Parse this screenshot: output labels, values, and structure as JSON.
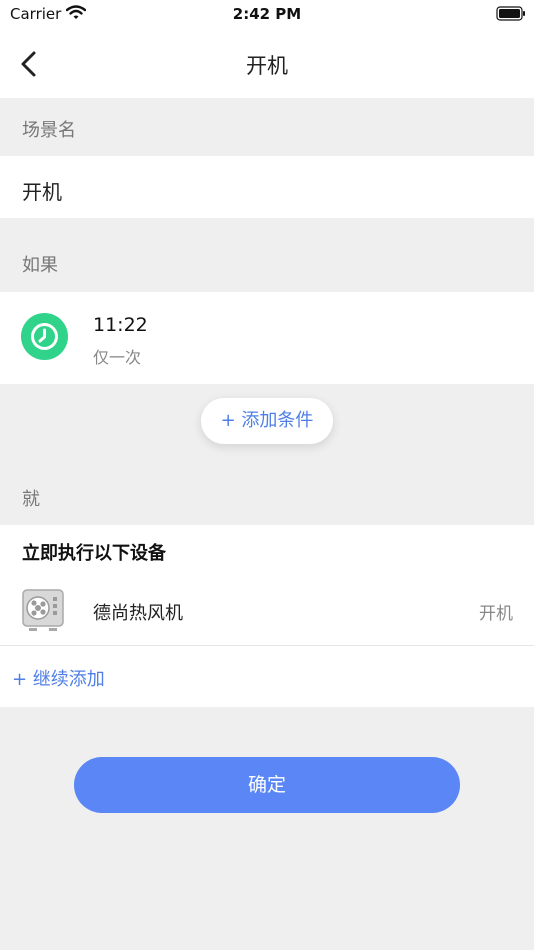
{
  "status_bar": {
    "carrier": "Carrier",
    "time": "2:42 PM"
  },
  "nav": {
    "title": "开机",
    "back_icon": "chevron-left-icon"
  },
  "scene_name": {
    "label": "场景名",
    "value": "开机"
  },
  "if_section": {
    "label": "如果",
    "condition": {
      "icon": "clock-icon",
      "time": "11:22",
      "repeat": "仅一次"
    },
    "add_condition_label": "+ 添加条件"
  },
  "then_section": {
    "label": "就",
    "exec_title": "立即执行以下设备",
    "device": {
      "icon": "heater-fan-icon",
      "name": "德尚热风机",
      "action": "开机"
    },
    "continue_add_label": "+ 继续添加"
  },
  "confirm_label": "确定",
  "colors": {
    "accent": "#5a87f5",
    "link": "#4f7fe6",
    "clock_green": "#2fd38a",
    "background": "#efefef"
  }
}
